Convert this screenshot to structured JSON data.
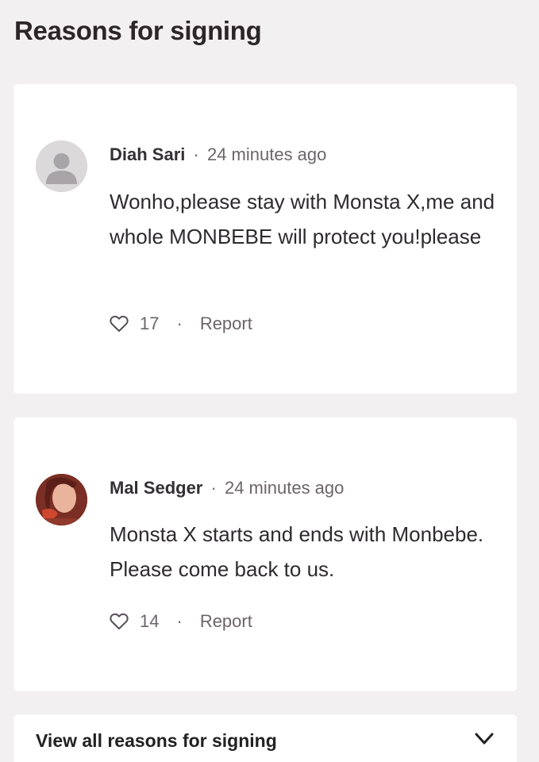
{
  "section": {
    "title": "Reasons for signing"
  },
  "comments": [
    {
      "author": "Diah Sari",
      "separator": "·",
      "time": "24 minutes ago",
      "text": "Wonho,please stay with Monsta X,me and whole MONBEBE will protect you!please",
      "likes": "17",
      "action_separator": "·",
      "report_label": "Report",
      "avatar": "default-user-avatar"
    },
    {
      "author": "Mal Sedger",
      "separator": "·",
      "time": "24 minutes ago",
      "text": "Monsta X starts and ends with Monbebe. Please come back to us.",
      "likes": "14",
      "action_separator": "·",
      "report_label": "Report",
      "avatar": "user-photo-avatar"
    }
  ],
  "footer": {
    "view_all_label": "View all reasons for signing",
    "icon": "chevron-down-icon"
  },
  "colors": {
    "background": "#f3f0f2",
    "card": "#ffffff",
    "text": "#2e2b2e",
    "muted": "#6b6669"
  }
}
